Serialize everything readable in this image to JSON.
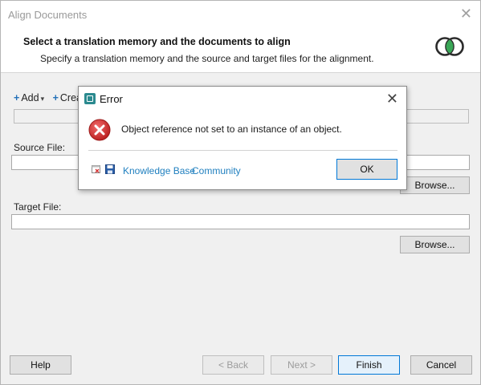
{
  "window": {
    "title": "Align Documents",
    "close_glyph": "✕"
  },
  "header": {
    "title": "Select a translation memory and the documents to align",
    "subtitle": "Specify a translation memory and the source and target files for the alignment.",
    "logo_icon": "overlapping-circles-icon"
  },
  "toolbar": {
    "add_label": "Add",
    "create_label": "Crea"
  },
  "source": {
    "label": "Source File:",
    "value": "",
    "browse_label": "Browse..."
  },
  "target": {
    "label": "Target File:",
    "value": "",
    "browse_label": "Browse..."
  },
  "footer": {
    "help_label": "Help",
    "back_label": "< Back",
    "next_label": "Next >",
    "finish_label": "Finish",
    "cancel_label": "Cancel"
  },
  "dialog": {
    "title": "Error",
    "close_glyph": "✕",
    "message": "Object reference not set to an instance of an object.",
    "icon": "error-x-icon",
    "links": [
      "Knowledge Base",
      "Community"
    ],
    "ok_label": "OK"
  },
  "colors": {
    "accent": "#0078d7",
    "link": "#1f7fbf",
    "error_red": "#d32f2f",
    "logo_green": "#3aa757"
  }
}
